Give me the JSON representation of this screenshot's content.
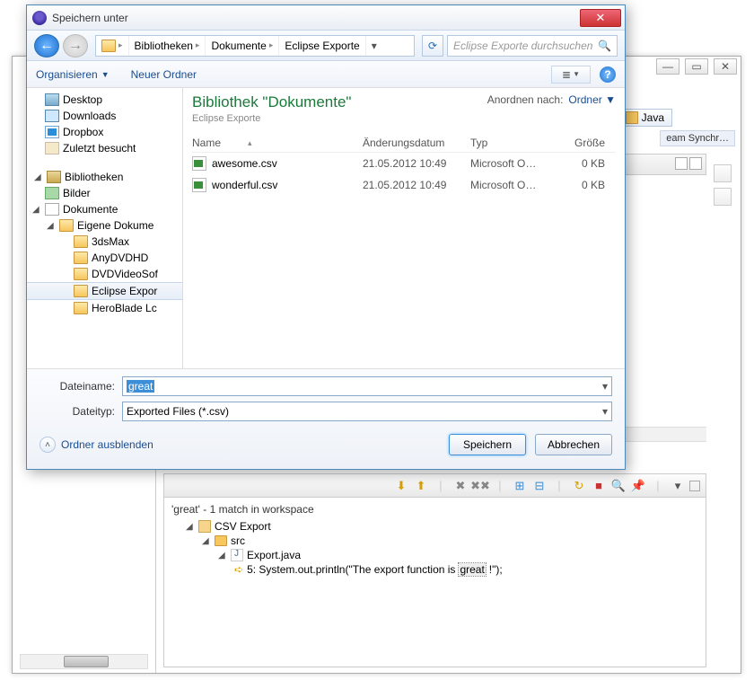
{
  "dialog": {
    "title": "Speichern unter",
    "breadcrumbs": [
      "Bibliotheken",
      "Dokumente",
      "Eclipse Exporte"
    ],
    "search_placeholder": "Eclipse Exporte durchsuchen",
    "organize": "Organisieren",
    "new_folder": "Neuer Ordner",
    "lib_title": "Bibliothek \"Dokumente\"",
    "lib_sub": "Eclipse Exporte",
    "arrange_label": "Anordnen nach:",
    "arrange_value": "Ordner",
    "cols": {
      "name": "Name",
      "date": "Änderungsdatum",
      "type": "Typ",
      "size": "Größe"
    },
    "tree": {
      "favorites": [
        "Desktop",
        "Downloads",
        "Dropbox",
        "Zuletzt besucht"
      ],
      "libs_label": "Bibliotheken",
      "pics": "Bilder",
      "docs": "Dokumente",
      "own": "Eigene Dokume",
      "folders": [
        "3dsMax",
        "AnyDVDHD",
        "DVDVideoSof",
        "Eclipse Expor",
        "HeroBlade Lc"
      ]
    },
    "files": [
      {
        "name": "awesome.csv",
        "date": "21.05.2012 10:49",
        "type": "Microsoft O…",
        "size": "0 KB"
      },
      {
        "name": "wonderful.csv",
        "date": "21.05.2012 10:49",
        "type": "Microsoft O…",
        "size": "0 KB"
      }
    ],
    "filename_label": "Dateiname:",
    "filename_value": "great",
    "filetype_label": "Dateityp:",
    "filetype_value": "Exported Files (*.csv)",
    "hide_folders": "Ordner ausblenden",
    "save": "Speichern",
    "cancel": "Abbrechen"
  },
  "eclipse": {
    "perspective": "Java",
    "team_sync": "eam Synchr…",
    "search_title": "'great' - 1 match in workspace",
    "project": "CSV Export",
    "src": "src",
    "file": "Export.java",
    "line_prefix": "5: System.out.println(\"The export function is ",
    "line_match": "great",
    "line_suffix": "!\");"
  }
}
